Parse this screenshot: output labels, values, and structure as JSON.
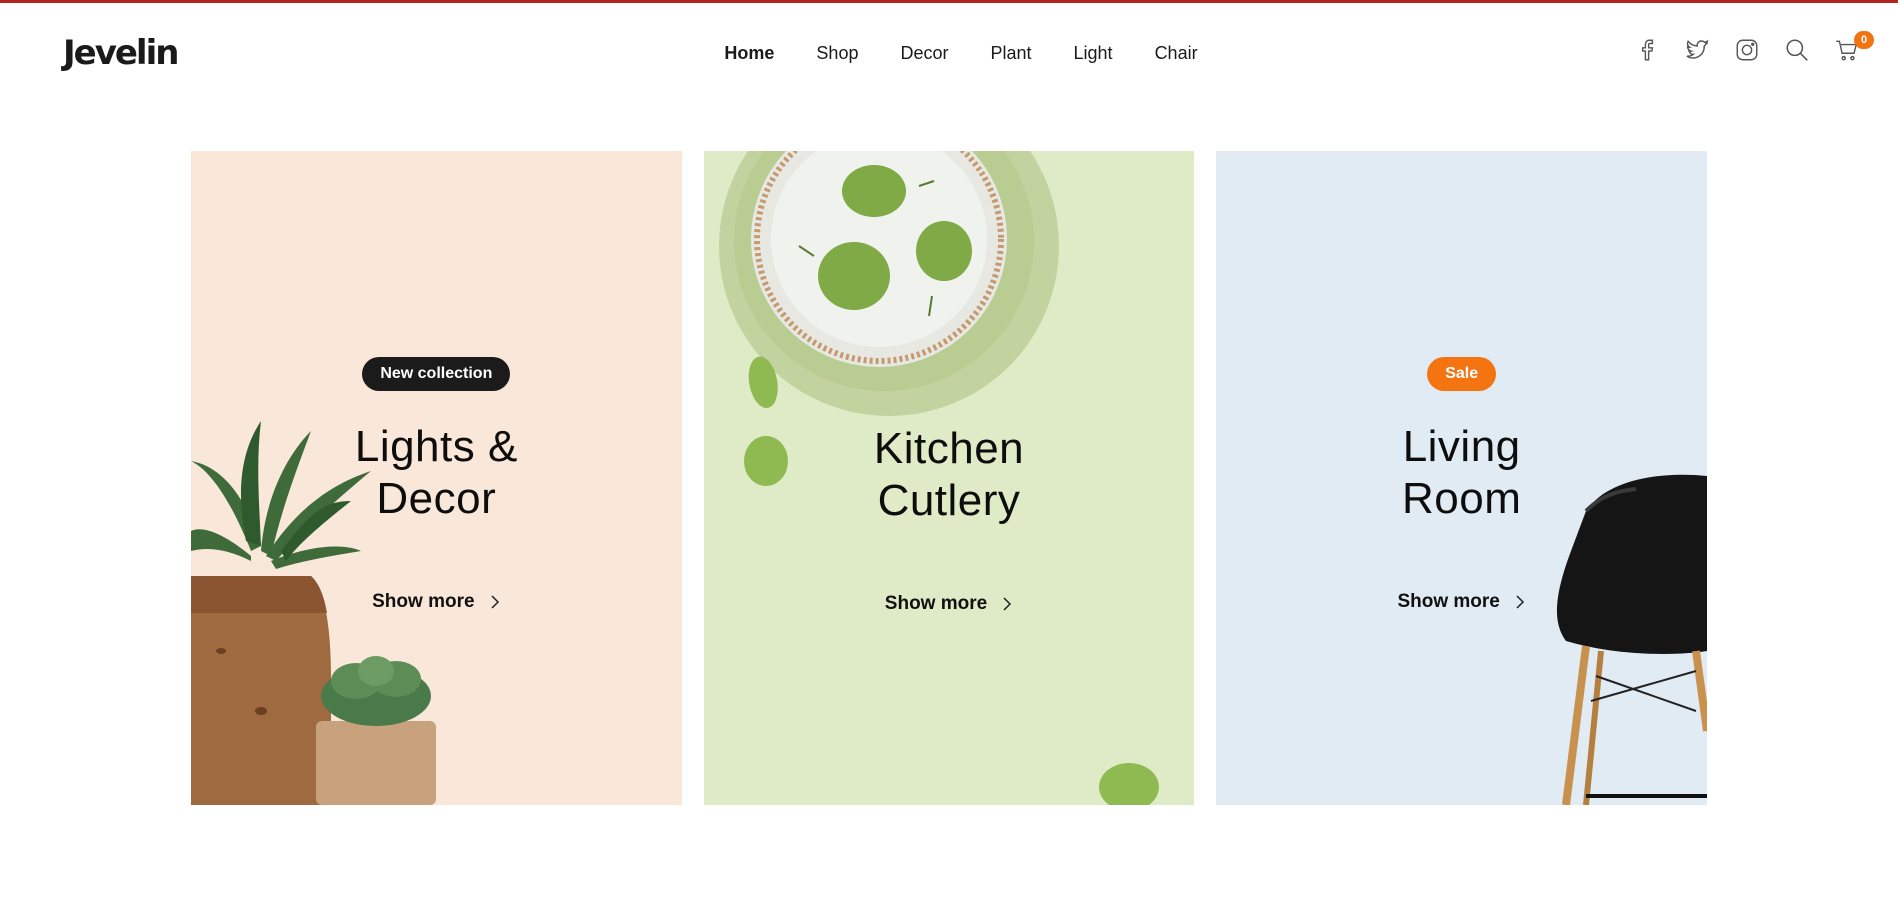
{
  "brand": {
    "logo": "Jevelin"
  },
  "nav": {
    "items": [
      {
        "label": "Home",
        "active": true
      },
      {
        "label": "Shop"
      },
      {
        "label": "Decor"
      },
      {
        "label": "Plant"
      },
      {
        "label": "Light"
      },
      {
        "label": "Chair"
      }
    ]
  },
  "header_icons": [
    "facebook-icon",
    "twitter-icon",
    "instagram-icon",
    "search-icon",
    "cart-icon"
  ],
  "cart": {
    "count": "0"
  },
  "cards": [
    {
      "badge": "New collection",
      "title_line1": "Lights &",
      "title_line2": "Decor",
      "link": "Show more",
      "bg": "#f9e7da"
    },
    {
      "badge": "",
      "title_line1": "Kitchen",
      "title_line2": "Cutlery",
      "link": "Show more",
      "bg": "#dfebc6"
    },
    {
      "badge": "Sale",
      "title_line1": "Living",
      "title_line2": "Room",
      "link": "Show more",
      "bg": "#e0ebf4"
    }
  ],
  "colors": {
    "accent": "#f57412",
    "top_bar": "#b3231f",
    "badge_dark": "#1b1b1b"
  }
}
